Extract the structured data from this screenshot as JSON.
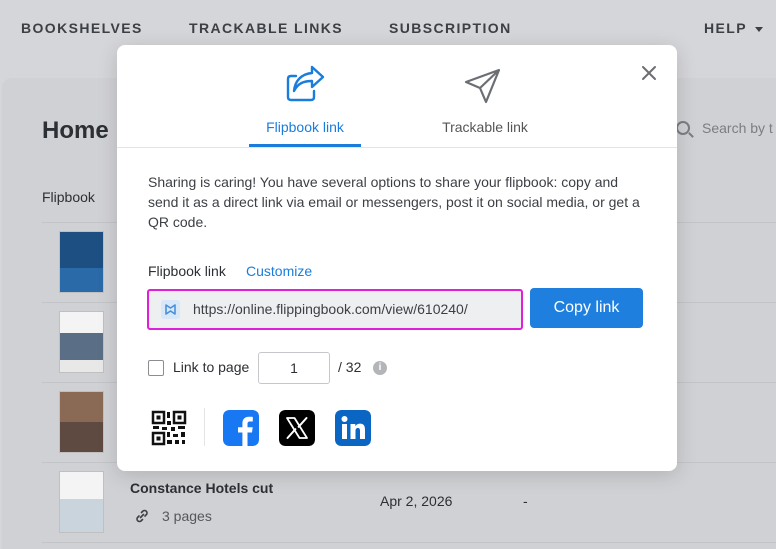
{
  "nav": {
    "bookshelves": "BOOKSHELVES",
    "trackable_links": "TRACKABLE LINKS",
    "subscription": "SUBSCRIPTION",
    "help": "HELP"
  },
  "background": {
    "title": "Home",
    "search_placeholder": "Search by t",
    "column_header": "Flipbook",
    "row": {
      "name": "Constance Hotels cut",
      "pages": "3 pages",
      "date": "Apr 2, 2026",
      "dash": "-"
    }
  },
  "modal": {
    "tabs": [
      {
        "label": "Flipbook link",
        "active": true,
        "icon": "share-arrow-icon"
      },
      {
        "label": "Trackable link",
        "active": false,
        "icon": "paper-plane-icon"
      }
    ],
    "description": "Sharing is caring! You have several options to share your flipbook: copy and send it as a direct link via email or messengers, post it on social media, or get a QR code.",
    "link_label": "Flipbook link",
    "customize_label": "Customize",
    "url": "https://online.flippingbook.com/view/610240/",
    "copy_button": "Copy link",
    "link_to_page_label": "Link to page",
    "page_value": "1",
    "page_total": "/ 32",
    "share_icons": [
      "qr-code-icon",
      "facebook-icon",
      "x-icon",
      "linkedin-icon"
    ]
  },
  "colors": {
    "accent": "#1a7ddc",
    "highlight_border": "#e020d8",
    "facebook": "#1877f2",
    "linkedin": "#0a66c2",
    "x": "#000000"
  }
}
